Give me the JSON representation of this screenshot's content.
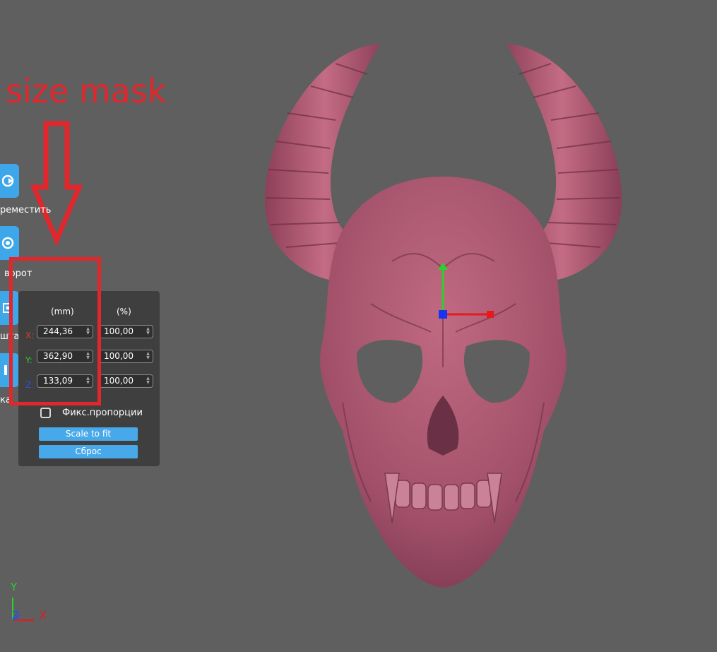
{
  "annotation": {
    "title": "size mask",
    "color": "#e1262c"
  },
  "toolbar": {
    "tools": [
      {
        "name": "move",
        "label": "реместить",
        "icon": "move-icon"
      },
      {
        "name": "rotate",
        "label": "ворот",
        "icon": "rotate-icon"
      },
      {
        "name": "scale",
        "label": "шта",
        "icon": "scale-icon"
      },
      {
        "name": "mirror",
        "label": "ка",
        "icon": "mirror-icon"
      }
    ]
  },
  "scale_panel": {
    "col_mm": "(mm)",
    "col_pct": "(%)",
    "rows": [
      {
        "axis": "X:",
        "mm": "244,36",
        "pct": "100,00",
        "axis_color": "#e23a2a"
      },
      {
        "axis": "Y:",
        "mm": "362,90",
        "pct": "100,00",
        "axis_color": "#2ecc2e"
      },
      {
        "axis": "Z:",
        "mm": "133,09",
        "pct": "100,00",
        "axis_color": "#2a50e8"
      }
    ],
    "lock_proportions_label": "Фикс.пропорции",
    "lock_proportions_checked": false,
    "scale_to_fit_label": "Scale to fit",
    "reset_label": "Сброс"
  },
  "axis_indicator": {
    "y": "Y",
    "z": "Z",
    "x": "X"
  },
  "colors": {
    "viewport_bg": "#5f5f5f",
    "model": "#b05a72",
    "accent": "#3ea7ea"
  }
}
